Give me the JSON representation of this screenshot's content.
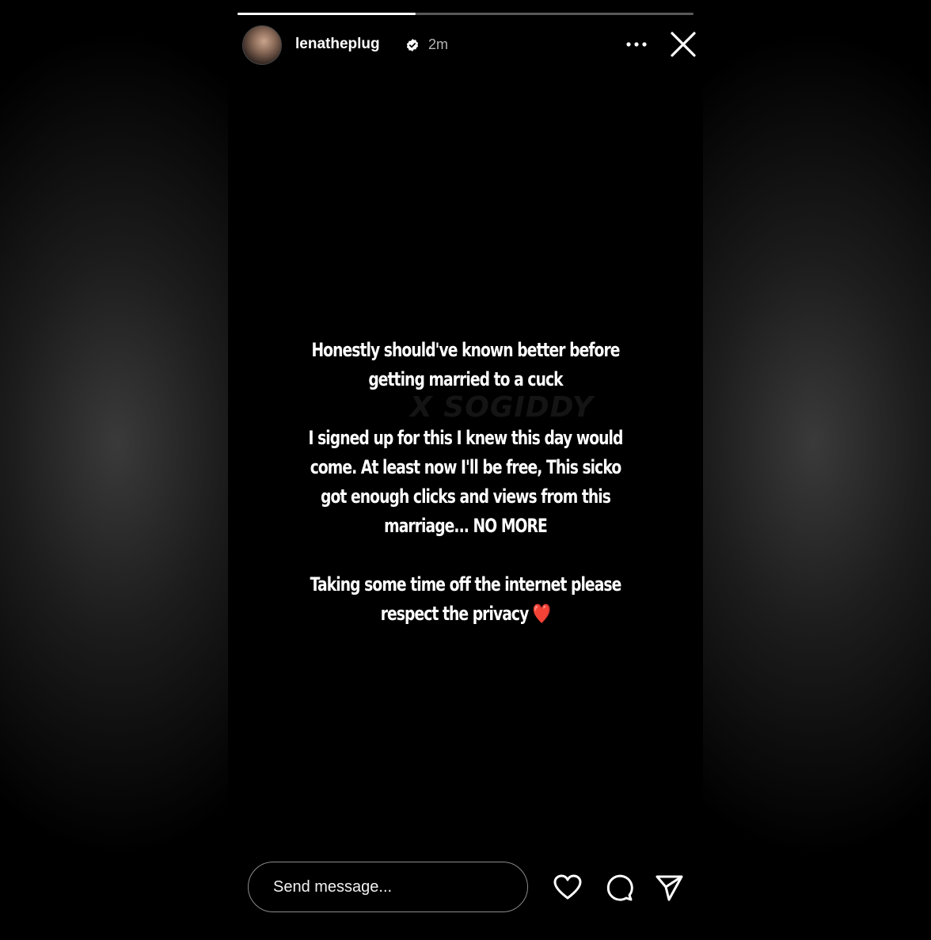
{
  "story": {
    "progress": 0.39,
    "username": "lenatheplug",
    "verified": true,
    "timestamp": "2m",
    "paragraphs": [
      "Honestly should've known better before getting married to a cuck",
      "I signed up for this I knew this day would come. At least now I'll be free, This sicko got enough clicks and views from this marriage... NO MORE",
      "Taking some time off the internet please respect the privacy ❤️"
    ],
    "watermark": "X SOGIDDY"
  },
  "bottom_bar": {
    "message_placeholder": "Send message..."
  },
  "icons": {
    "more": "more-horizontal-icon",
    "close": "close-icon",
    "like": "heart-icon",
    "reply": "comment-bubble-icon",
    "share": "send-icon",
    "verified": "verified-badge-icon"
  },
  "colors": {
    "background": "#000000",
    "text": "#ffffff",
    "timestamp": "#b5b5b5",
    "verified_badge": "#ffffff"
  }
}
